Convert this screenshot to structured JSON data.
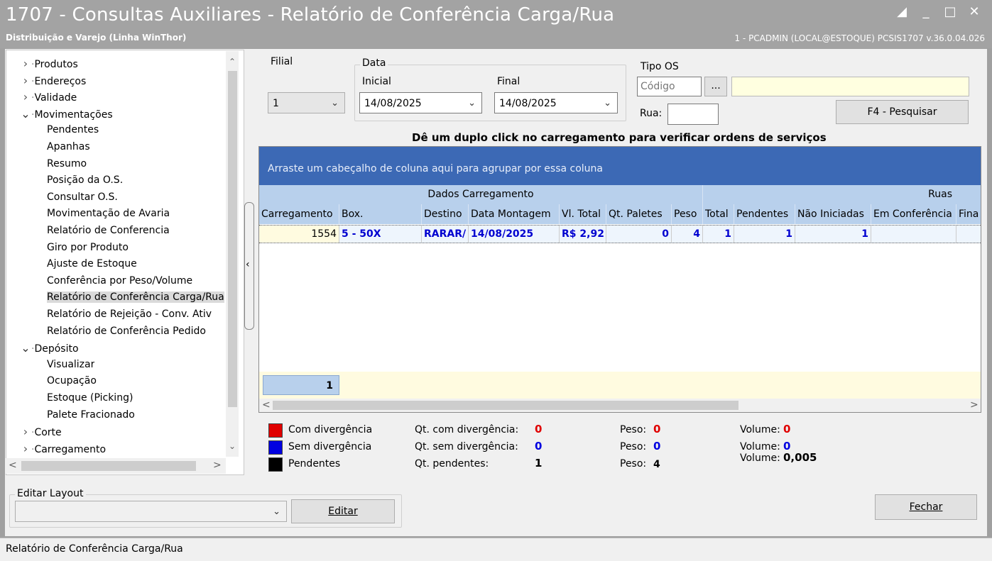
{
  "window": {
    "title": "1707 - Consultas Auxiliares - Relatório de Conferência Carga/Rua",
    "subtitle": "Distribuição e Varejo (Linha WinThor)",
    "user_info": "1 - PCADMIN (LOCAL@ESTOQUE)  PCSIS1707  v.36.0.04.026"
  },
  "tree": {
    "items": [
      {
        "label": "Produtos",
        "toggle": ">"
      },
      {
        "label": "Endereços",
        "toggle": ">"
      },
      {
        "label": "Validade",
        "toggle": ">"
      },
      {
        "label": "Movimentações",
        "toggle": "v"
      },
      {
        "label": "Pendentes"
      },
      {
        "label": "Apanhas"
      },
      {
        "label": "Resumo"
      },
      {
        "label": "Posição da O.S."
      },
      {
        "label": "Consultar O.S."
      },
      {
        "label": "Movimentação de Avaria"
      },
      {
        "label": "Relatório de Conferencia"
      },
      {
        "label": "Giro por Produto"
      },
      {
        "label": "Ajuste de Estoque"
      },
      {
        "label": "Conferência por Peso/Volume"
      },
      {
        "label": "Relatório de Conferência Carga/Rua",
        "selected": true
      },
      {
        "label": "Relatório de Rejeição - Conv. Ativ"
      },
      {
        "label": "Relatório de Conferência Pedido"
      },
      {
        "label": "Depósito",
        "toggle": "v"
      },
      {
        "label": "Visualizar"
      },
      {
        "label": "Ocupação"
      },
      {
        "label": "Estoque (Picking)"
      },
      {
        "label": "Palete Fracionado"
      },
      {
        "label": "Corte",
        "toggle": ">"
      },
      {
        "label": "Carregamento",
        "toggle": ">"
      }
    ]
  },
  "filters": {
    "filial_label": "Filial",
    "filial_value": "1",
    "data_group": "Data",
    "inicial_label": "Inicial",
    "inicial_value": "14/08/2025",
    "final_label": "Final",
    "final_value": "14/08/2025",
    "tipo_os_label": "Tipo OS",
    "codigo_placeholder": "Código",
    "ellipsis": "...",
    "rua_label": "Rua:",
    "pesquisar_label": "F4 - Pesquisar"
  },
  "hint": "Dê um duplo click no carregamento para verificar ordens de serviços",
  "grid": {
    "group_hint": "Arraste um cabeçalho de coluna aqui para agrupar por essa coluna",
    "bands": [
      "Dados Carregamento",
      "Ruas"
    ],
    "columns": [
      "Carregamento",
      "Box.",
      "Destino",
      "Data Montagem",
      "Vl. Total",
      "Qt. Paletes",
      "Peso",
      "Total",
      "Pendentes",
      "Não Iniciadas",
      "Em Conferência",
      "Fina"
    ],
    "rows": [
      [
        "1554",
        "5 - 50X",
        "RARAR/",
        "14/08/2025",
        "R$ 2,92",
        "0",
        "4",
        "1",
        "1",
        "1",
        "",
        ""
      ]
    ],
    "footer_count": "1"
  },
  "legend": {
    "com_div": "Com divergência",
    "sem_div": "Sem divergência",
    "pend": "Pendentes",
    "qt_com_label": "Qt. com divergência:",
    "qt_com_value": "0",
    "qt_sem_label": "Qt. sem divergência:",
    "qt_sem_value": "0",
    "qt_pend_label": "Qt. pendentes:",
    "qt_pend_value": "1",
    "peso_label": "Peso:",
    "peso_com": "0",
    "peso_sem": "0",
    "peso_pend": "4",
    "volume_label": "Volume:",
    "vol_com": "0",
    "vol_sem": "0",
    "vol_pend": "0,005",
    "colors": {
      "com": "#e00000",
      "sem": "#0000e0",
      "pend": "#000000"
    }
  },
  "layout_editor": {
    "group": "Editar Layout",
    "editar": "Editar",
    "fechar": "Fechar"
  },
  "status": "Relatório de Conferência Carga/Rua"
}
